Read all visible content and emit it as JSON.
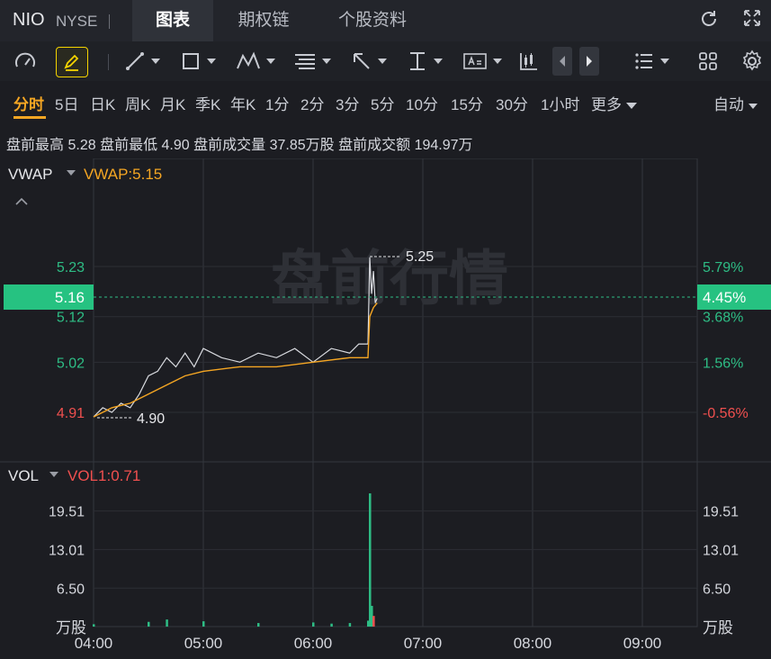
{
  "header": {
    "ticker": "NIO",
    "exchange": "NYSE",
    "tabs": [
      {
        "label": "图表",
        "active": true
      },
      {
        "label": "期权链",
        "active": false
      },
      {
        "label": "个股资料",
        "active": false
      }
    ]
  },
  "toolbar": {
    "icons": [
      "speedometer-icon",
      "pencil-icon",
      "line-tool-icon",
      "rectangle-tool-icon",
      "pattern-tool-icon",
      "fib-tool-icon",
      "arrow-tool-icon",
      "text-tool-icon",
      "text-label-icon",
      "candles-icon",
      "prev-icon",
      "next-icon",
      "list-icon",
      "grid-icon",
      "settings-icon"
    ],
    "accent": "#f5d400"
  },
  "periods": {
    "items": [
      "分时",
      "5日",
      "日K",
      "周K",
      "月K",
      "季K",
      "年K",
      "1分",
      "2分",
      "3分",
      "5分",
      "10分",
      "15分",
      "30分",
      "1小时",
      "更多"
    ],
    "active": "分时",
    "auto_label": "自动"
  },
  "info": {
    "high_label": "盘前最高",
    "high_value": "5.28",
    "low_label": "盘前最低",
    "low_value": "4.90",
    "vol_label": "盘前成交量",
    "vol_value": "37.85万股",
    "amt_label": "盘前成交额",
    "amt_value": "194.97万"
  },
  "main_chart": {
    "indicator": "VWAP",
    "indicator_value": "VWAP:5.15",
    "watermark": "盘前行情",
    "current_price": "5.16",
    "current_pct": "4.45%",
    "y_ticks": [
      {
        "price": "5.23",
        "pct": "5.79%",
        "value": 5.23,
        "color": "#2ebd85"
      },
      {
        "price": "5.12",
        "pct": "3.68%",
        "value": 5.12,
        "color": "#2ebd85"
      },
      {
        "price": "5.02",
        "pct": "1.56%",
        "value": 5.02,
        "color": "#2ebd85"
      },
      {
        "price": "4.91",
        "pct": "-0.56%",
        "value": 4.91,
        "color": "#f0504f"
      }
    ],
    "high_marker": "5.25",
    "low_marker": "4.90"
  },
  "vol_chart": {
    "indicator": "VOL",
    "indicator_value": "VOL1:0.71",
    "y_ticks": [
      "19.51",
      "13.01",
      "6.50"
    ],
    "unit": "万股"
  },
  "x_ticks": [
    "04:00",
    "05:00",
    "06:00",
    "07:00",
    "08:00",
    "09:00"
  ],
  "colors": {
    "up": "#2ebd85",
    "down": "#f0504f",
    "price_line": "#d9dbe0",
    "vwap_line": "#f5a623",
    "current_bg": "#26c281"
  },
  "chart_data": {
    "type": "line",
    "series": [
      {
        "name": "VWAP",
        "x": [
          "04:00",
          "04:05",
          "04:10",
          "04:20",
          "04:30",
          "04:40",
          "04:50",
          "05:00",
          "05:20",
          "05:40",
          "06:00",
          "06:20",
          "06:30",
          "06:31",
          "06:33",
          "06:35"
        ],
        "values": [
          4.9,
          4.91,
          4.92,
          4.93,
          4.95,
          4.97,
          4.99,
          5.0,
          5.01,
          5.01,
          5.02,
          5.03,
          5.03,
          5.12,
          5.14,
          5.15
        ]
      }
    ],
    "price_x": [
      "04:00",
      "04:05",
      "04:10",
      "04:15",
      "04:20",
      "04:25",
      "04:30",
      "04:35",
      "04:40",
      "04:45",
      "04:50",
      "04:55",
      "05:00",
      "05:10",
      "05:20",
      "05:30",
      "05:40",
      "05:50",
      "06:00",
      "06:10",
      "06:20",
      "06:25",
      "06:30",
      "06:31",
      "06:32",
      "06:33",
      "06:34",
      "06:35"
    ],
    "price_values": [
      4.9,
      4.92,
      4.91,
      4.93,
      4.92,
      4.95,
      4.99,
      5.0,
      5.03,
      5.01,
      5.04,
      5.01,
      5.05,
      5.03,
      5.02,
      5.04,
      5.03,
      5.05,
      5.02,
      5.05,
      5.04,
      5.06,
      5.06,
      5.25,
      5.17,
      5.22,
      5.15,
      5.16
    ],
    "volume_x": [
      "04:00",
      "04:30",
      "04:40",
      "05:00",
      "05:30",
      "06:00",
      "06:10",
      "06:20",
      "06:30",
      "06:31",
      "06:32",
      "06:33"
    ],
    "volume_values": [
      0.4,
      0.8,
      1.2,
      0.9,
      0.6,
      0.7,
      0.5,
      0.6,
      1.0,
      22.5,
      3.5,
      1.8
    ],
    "ylim": [
      4.86,
      5.3
    ],
    "volume_ylim": [
      0,
      26
    ],
    "xlim": [
      "04:00",
      "09:30"
    ],
    "grid": true
  }
}
